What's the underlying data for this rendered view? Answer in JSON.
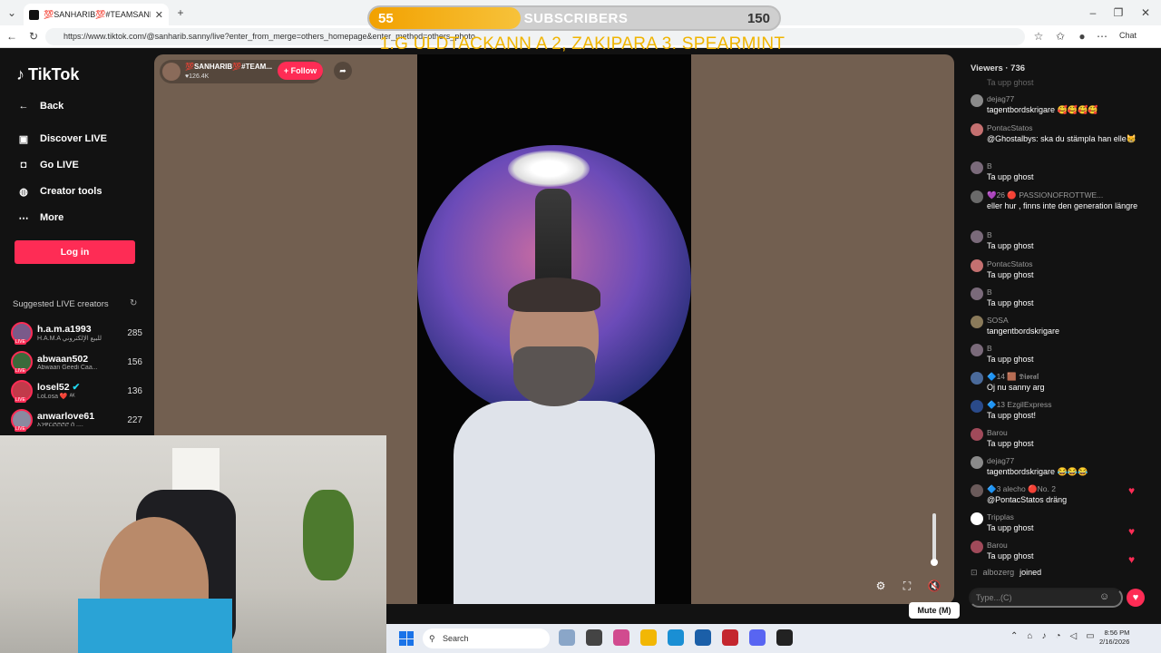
{
  "browser": {
    "tab_title": "💯SANHARIB💯#TEAMSANHARIB",
    "url": "https://www.tiktok.com/@sanharib.sanny/live?enter_from_merge=others_homepage&enter_method=others_photo",
    "chat_button": "Chat"
  },
  "overlay": {
    "sub_current": "55",
    "sub_label": "SUBSCRIBERS",
    "sub_goal": "150",
    "sub_progress": 0.37,
    "ticker": "1.G ULDTACKANN A 2, ZAKIPARA  3. SPEARMINT",
    "accent": "#f2a100"
  },
  "sidebar": {
    "logo": "TikTok",
    "back": "Back",
    "nav": [
      {
        "label": "Discover LIVE",
        "icon": "calendar-icon"
      },
      {
        "label": "Go LIVE",
        "icon": "camera-icon"
      },
      {
        "label": "Creator tools",
        "icon": "bulb-icon"
      },
      {
        "label": "More",
        "icon": "more-icon"
      }
    ],
    "login": "Log in",
    "suggested_title": "Suggested LIVE creators",
    "creators": [
      {
        "name": "h.a.m.a1993",
        "sub": "H.A.M.A للبيع الإلكتروني",
        "count": "285",
        "color": "#7a5a8a"
      },
      {
        "name": "abwaan502",
        "sub": "Abwaan Geedi Caa...",
        "count": "156",
        "color": "#3b6a3b"
      },
      {
        "name": "losel52",
        "sub": "LoLosa ❤️ ᴬᴷ",
        "count": "136",
        "color": "#c23a4a"
      },
      {
        "name": "anwarlove61",
        "sub": "አንዋርሮሮሮሮ ሰ ....",
        "count": "227",
        "color": "#8a8aa0"
      }
    ]
  },
  "stage": {
    "host_name": "💯SANHARIB💯#TEAM...",
    "host_likes": "♥126.4K",
    "follow": "+ Follow",
    "tooltip": "Mute (M)",
    "stage_color": "#725f50"
  },
  "chat": {
    "viewers": "Viewers · 736",
    "input_placeholder": "Type...(C)",
    "top_fade": "Ta upp ghost",
    "messages": [
      {
        "user": "dejag77",
        "text": "tagentbordskrigare 🥰🥰🥰🥰",
        "color": "#8a8a8a"
      },
      {
        "user": "PontacStatos",
        "text": "@Ghostalbys: ska du stämpla han elle😸",
        "color": "#c47070"
      },
      {
        "user": "B",
        "text": "Ta upp ghost",
        "color": "#7a6a7a"
      },
      {
        "user": "💜26 🔴 PASSIONOFROTTWE...",
        "text": "eller hur , finns inte den generation längre",
        "color": "#6a6a6a"
      },
      {
        "user": "B",
        "text": "Ta upp ghost",
        "color": "#7a6a7a"
      },
      {
        "user": "PontacStatos",
        "text": "Ta upp ghost",
        "color": "#c47070"
      },
      {
        "user": "B",
        "text": "Ta upp ghost",
        "color": "#7a6a7a"
      },
      {
        "user": "SOSA",
        "text": "tangentbordskrigare",
        "color": "#8a7a5a"
      },
      {
        "user": "B",
        "text": "Ta upp ghost",
        "color": "#7a6a7a"
      },
      {
        "user": "🔷14 🟫 𝕯𝖎𝖔𝖗𝖆𝖑",
        "text": "Oj nu sanny arg",
        "color": "#4a6a9a"
      },
      {
        "user": "🔷13 EzgilExpress",
        "text": "Ta upp ghost!",
        "color": "#2a4a8a"
      },
      {
        "user": "Barou",
        "text": "Ta upp ghost",
        "color": "#a04a5a"
      },
      {
        "user": "dejag77",
        "text": "tagentbordskrigare 😂😂😂",
        "color": "#8a8a8a"
      },
      {
        "user": "🔷3 alecho 🔴No. 2",
        "text": "@PontacStatos dräng",
        "color": "#6a5a5a"
      },
      {
        "user": "Tripplas",
        "text": "Ta upp ghost",
        "color": "#ffffff"
      },
      {
        "user": "Barou",
        "text": "Ta upp ghost",
        "color": "#a04a5a"
      }
    ],
    "joined_user": "albozerg",
    "joined_text": "joined"
  },
  "taskbar": {
    "search": "Search",
    "time": "8:56 PM",
    "date": "2/16/2026"
  }
}
